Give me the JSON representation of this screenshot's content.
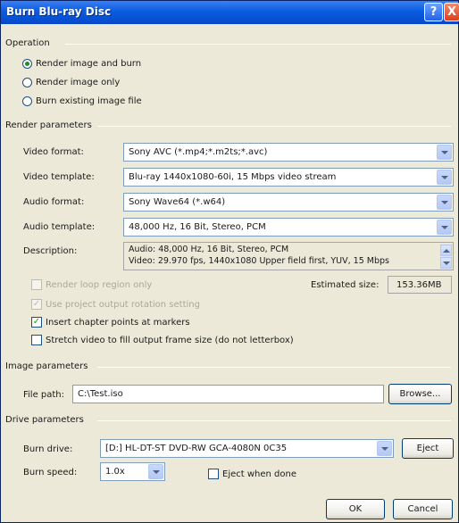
{
  "window": {
    "title": "Burn Blu-ray Disc",
    "help_glyph": "?",
    "close_glyph": "X"
  },
  "operation": {
    "label": "Operation",
    "options": [
      "Render image and burn",
      "Render image only",
      "Burn existing image file"
    ],
    "selected": "Render image and burn"
  },
  "render": {
    "label": "Render parameters",
    "video_format": {
      "label": "Video format:",
      "value": "Sony AVC (*.mp4;*.m2ts;*.avc)"
    },
    "video_template": {
      "label": "Video template:",
      "value": "Blu-ray 1440x1080-60i, 15 Mbps video stream"
    },
    "audio_format": {
      "label": "Audio format:",
      "value": "Sony Wave64 (*.w64)"
    },
    "audio_template": {
      "label": "Audio template:",
      "value": "48,000 Hz, 16 Bit, Stereo, PCM"
    },
    "description": {
      "label": "Description:",
      "line1": "Audio: 48,000 Hz, 16 Bit, Stereo, PCM",
      "line2": "Video: 29.970 fps, 1440x1080 Upper field first, YUV, 15 Mbps"
    },
    "render_loop": {
      "label": "Render loop region only",
      "checked": false,
      "enabled": false
    },
    "use_rotation": {
      "label": "Use project output rotation setting",
      "checked": true,
      "enabled": false
    },
    "insert_chapters": {
      "label": "Insert chapter points at markers",
      "checked": true,
      "enabled": true
    },
    "stretch_video": {
      "label": "Stretch video to fill output frame size (do not letterbox)",
      "checked": false,
      "enabled": true
    },
    "estimated_size": {
      "label": "Estimated size:",
      "value": "153.36MB"
    }
  },
  "image": {
    "label": "Image parameters",
    "file_path": {
      "label": "File path:",
      "value": "C:\\Test.iso"
    },
    "browse_label": "Browse..."
  },
  "drive": {
    "label": "Drive parameters",
    "burn_drive": {
      "label": "Burn drive:",
      "value": "[D:] HL-DT-ST DVD-RW GCA-4080N 0C35"
    },
    "eject_label": "Eject",
    "burn_speed": {
      "label": "Burn speed:",
      "value": "1.0x"
    },
    "eject_when_done": {
      "label": "Eject when done",
      "checked": false
    }
  },
  "footer": {
    "ok_label": "OK",
    "cancel_label": "Cancel"
  },
  "colors": {
    "title_bar": "#0648c8",
    "dialog_bg": "#ece9d8",
    "field_border": "#7f9db9",
    "check_green": "#21a121"
  }
}
